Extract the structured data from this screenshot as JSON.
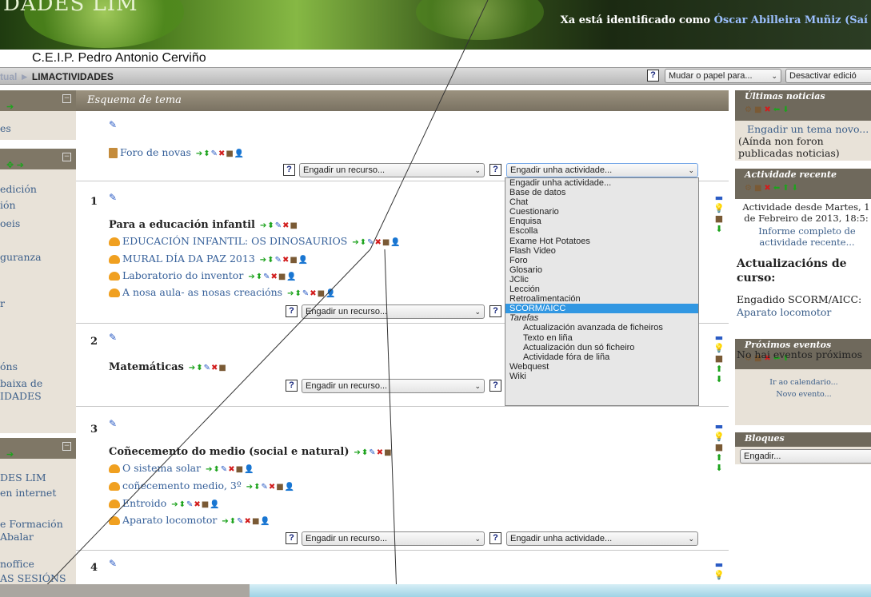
{
  "banner": {
    "title": "DADES LIM",
    "login_text": "Xa está identificado como",
    "user": "Óscar Abilleira Muñiz",
    "logout": "(Saí"
  },
  "school": "C.E.I.P. Pedro Antonio Cerviño",
  "breadcrumb": {
    "prev": "tual",
    "sep": "►",
    "current": "LIMACTIVIDADES"
  },
  "header": {
    "help": "?",
    "role_select": "Mudar o papel para...",
    "edit_button": "Desactivar edició"
  },
  "left": {
    "b1": [
      "es"
    ],
    "b2": [
      "edición",
      "ión",
      "oeis",
      "guranza",
      "r",
      "óns",
      "baixa de",
      "IDADES"
    ],
    "b3": [
      "DES LIM",
      "en internet",
      "e Formación",
      "Abalar",
      "noffice",
      "AS SESIÓNS"
    ]
  },
  "main": {
    "heading": "Esquema de tema",
    "forum": "Foro de novas",
    "add_resource": "Engadir un recurso...",
    "add_activity": "Engadir unha actividade...",
    "sections": [
      {
        "num": "1",
        "title": "Para a educación infantil",
        "acts": [
          "EDUCACIÓN INFANTIL: OS DINOSAURIOS",
          "MURAL DÍA DA PAZ 2013",
          "Laboratorio do inventor",
          "A nosa aula- as nosas creacións"
        ]
      },
      {
        "num": "2",
        "title": "Matemáticas",
        "acts": []
      },
      {
        "num": "3",
        "title": "Coñecemento do medio (social e natural)",
        "acts": [
          "O sistema solar",
          "coñecemento medio, 3º",
          "Entroido",
          "Aparato locomotor"
        ]
      },
      {
        "num": "4",
        "title": "",
        "acts": []
      }
    ]
  },
  "dropdown": {
    "items": [
      "Engadir unha actividade...",
      "Base de datos",
      "Chat",
      "Cuestionario",
      "Enquisa",
      "Escolla",
      "Exame Hot Potatoes",
      "Flash Video",
      "Foro",
      "Glosario",
      "JClic",
      "Lección",
      "Retroalimentación",
      "SCORM/AICC"
    ],
    "selected": "SCORM/AICC",
    "group": "Tarefas",
    "sub": [
      "Actualización avanzada de ficheiros",
      "Texto en liña",
      "Actualización dun só ficheiro",
      "Actividade fóra de liña"
    ],
    "tail": [
      "Webquest",
      "Wiki"
    ]
  },
  "right": {
    "news": {
      "title": "Últimas noticias",
      "add": "Engadir un tema novo...",
      "none": "(Aínda non foron publicadas noticias)"
    },
    "recent": {
      "title": "Actividade recente",
      "since": "Actividade desde Martes, 1 de Febreiro de 2013, 18:5:",
      "report": "Informe completo de actividade recente...",
      "updates": "Actualizacións de curso:",
      "added": "Engadido SCORM/AICC:",
      "item": "Aparato locomotor"
    },
    "events": {
      "title": "Próximos eventos",
      "none": "No hai eventos próximos",
      "calendar": "Ir ao calendario...",
      "new": "Novo evento..."
    },
    "blocks": {
      "title": "Bloques",
      "add": "Engadir..."
    }
  }
}
